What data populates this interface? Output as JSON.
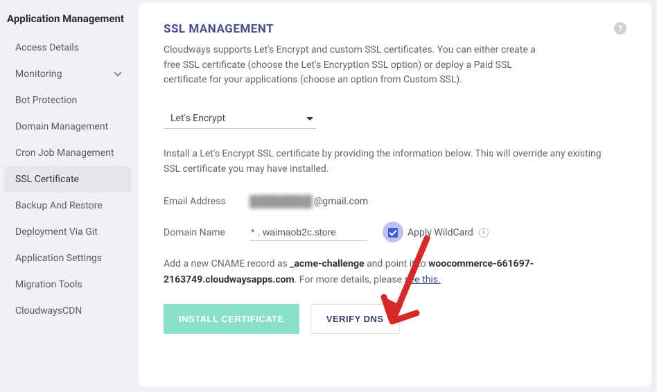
{
  "sidebar": {
    "title": "Application Management",
    "items": [
      {
        "label": "Access Details",
        "active": false,
        "hasChevron": false
      },
      {
        "label": "Monitoring",
        "active": false,
        "hasChevron": true
      },
      {
        "label": "Bot Protection",
        "active": false,
        "hasChevron": false
      },
      {
        "label": "Domain Management",
        "active": false,
        "hasChevron": false
      },
      {
        "label": "Cron Job Management",
        "active": false,
        "hasChevron": false
      },
      {
        "label": "SSL Certificate",
        "active": true,
        "hasChevron": false
      },
      {
        "label": "Backup And Restore",
        "active": false,
        "hasChevron": false
      },
      {
        "label": "Deployment Via Git",
        "active": false,
        "hasChevron": false
      },
      {
        "label": "Application Settings",
        "active": false,
        "hasChevron": false
      },
      {
        "label": "Migration Tools",
        "active": false,
        "hasChevron": false
      },
      {
        "label": "CloudwaysCDN",
        "active": false,
        "hasChevron": false
      }
    ]
  },
  "header": {
    "title": "SSL MANAGEMENT",
    "description": "Cloudways supports Let's Encrypt and custom SSL certificates. You can either create a free SSL certificate (choose the Let's Encryption SSL option) or deploy a Paid SSL certificate for your applications (choose an option from Custom SSL).",
    "helpGlyph": "?"
  },
  "sslSelect": {
    "value": "Let's Encrypt"
  },
  "instructions": "Install a Let's Encrypt SSL certificate by providing the information below. This will override any existing SSL certificate you may have installed.",
  "fields": {
    "emailLabel": "Email Address",
    "emailMasked": "████████",
    "emailSuffix": "@gmail.com",
    "domainLabel": "Domain Name",
    "domainValue": "* . waimaob2c.store",
    "wildcardLabel": "Apply WildCard",
    "wildcardChecked": true
  },
  "cname": {
    "prefix": "Add a new CNAME record as ",
    "record": "_acme-challenge",
    "mid": " and point it to ",
    "host": "woocommerce-661697-2163749.cloudwaysapps.com",
    "suffix": ". For more details, please  ",
    "linkText": "see this."
  },
  "buttons": {
    "install": "INSTALL CERTIFICATE",
    "verify": "VERIFY DNS"
  },
  "annotation": {
    "color": "#d62a2a"
  }
}
